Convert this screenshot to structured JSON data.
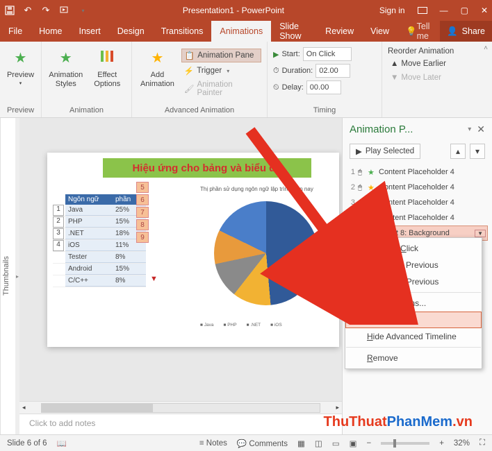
{
  "titlebar": {
    "title": "Presentation1 - PowerPoint",
    "signin": "Sign in"
  },
  "menu": {
    "file": "File",
    "home": "Home",
    "insert": "Insert",
    "design": "Design",
    "transitions": "Transitions",
    "animations": "Animations",
    "slideshow": "Slide Show",
    "review": "Review",
    "view": "View",
    "tellme": "Tell me",
    "share": "Share"
  },
  "ribbon": {
    "preview": "Preview",
    "preview_g": "Preview",
    "animstyles": "Animation\nStyles",
    "effectopt": "Effect\nOptions",
    "anim_g": "Animation",
    "addanim": "Add\nAnimation",
    "animpane": "Animation Pane",
    "trigger": "Trigger",
    "animpainter": "Animation Painter",
    "adv_g": "Advanced Animation",
    "start": "Start:",
    "start_val": "On Click",
    "duration": "Duration:",
    "duration_val": "02.00",
    "delay": "Delay:",
    "delay_val": "00.00",
    "timing_g": "Timing",
    "reorder": "Reorder Animation",
    "earlier": "Move Earlier",
    "later": "Move Later"
  },
  "thumbs_label": "Thumbnails",
  "slide": {
    "title": "Hiệu ứng cho bảng và biểu đồ",
    "chart_title": "Thị phần sử dụng ngôn ngữ lập trình hiện nay",
    "hdr1": "Ngôn ngữ",
    "hdr2": "phần",
    "rows": [
      {
        "i": "1",
        "n": "Java",
        "v": "25%"
      },
      {
        "i": "2",
        "n": "PHP",
        "v": "15%"
      },
      {
        "i": "3",
        "n": ".NET",
        "v": "18%"
      },
      {
        "i": "4",
        "n": "iOS",
        "v": "11%"
      },
      {
        "i": "",
        "n": "Tester",
        "v": "8%"
      },
      {
        "i": "",
        "n": "Android",
        "v": "15%"
      },
      {
        "i": "",
        "n": "C/C++",
        "v": "8%"
      }
    ],
    "nbox": [
      "5",
      "6",
      "7",
      "8",
      "9"
    ],
    "legend": [
      "Java",
      "PHP",
      ".NET",
      "iOS"
    ]
  },
  "chart_data": {
    "type": "pie",
    "title": "Thị phần sử dụng ngôn ngữ lập trình hiện nay",
    "categories": [
      "Java",
      "PHP",
      ".NET",
      "iOS",
      "Tester",
      "Android",
      "C/C++"
    ],
    "values": [
      25,
      15,
      18,
      11,
      8,
      15,
      8
    ]
  },
  "notes": "Click to add notes",
  "animpane": {
    "title": "Animation P...",
    "play": "Play Selected",
    "items": [
      {
        "n": "1",
        "star": "#4caf50",
        "type": "star",
        "t": "Content Placeholder 4"
      },
      {
        "n": "2",
        "star": "#ffb300",
        "type": "star",
        "t": "Content Placeholder 4"
      },
      {
        "n": "3",
        "star": "#d84b2a",
        "type": "bar",
        "t": "Content Placeholder 4"
      },
      {
        "n": "4",
        "star": "#d84b2a",
        "type": "star",
        "t": "Content Placeholder 4"
      },
      {
        "n": "5",
        "star": "#4caf50",
        "type": "star",
        "t": "Chart 8: Background"
      }
    ]
  },
  "ctx": {
    "start_click": "Start On Click",
    "start_with": "Start With Previous",
    "start_after": "Start After Previous",
    "effect": "Effect Options...",
    "timing": "Timing...",
    "hide": "Hide Advanced Timeline",
    "remove": "Remove"
  },
  "status": {
    "slide": "Slide 6 of 6",
    "notes": "Notes",
    "comments": "Comments",
    "zoom": "32%"
  },
  "watermark": {
    "a": "ThuThuat",
    "b": "PhanMem",
    "c": ".vn"
  }
}
